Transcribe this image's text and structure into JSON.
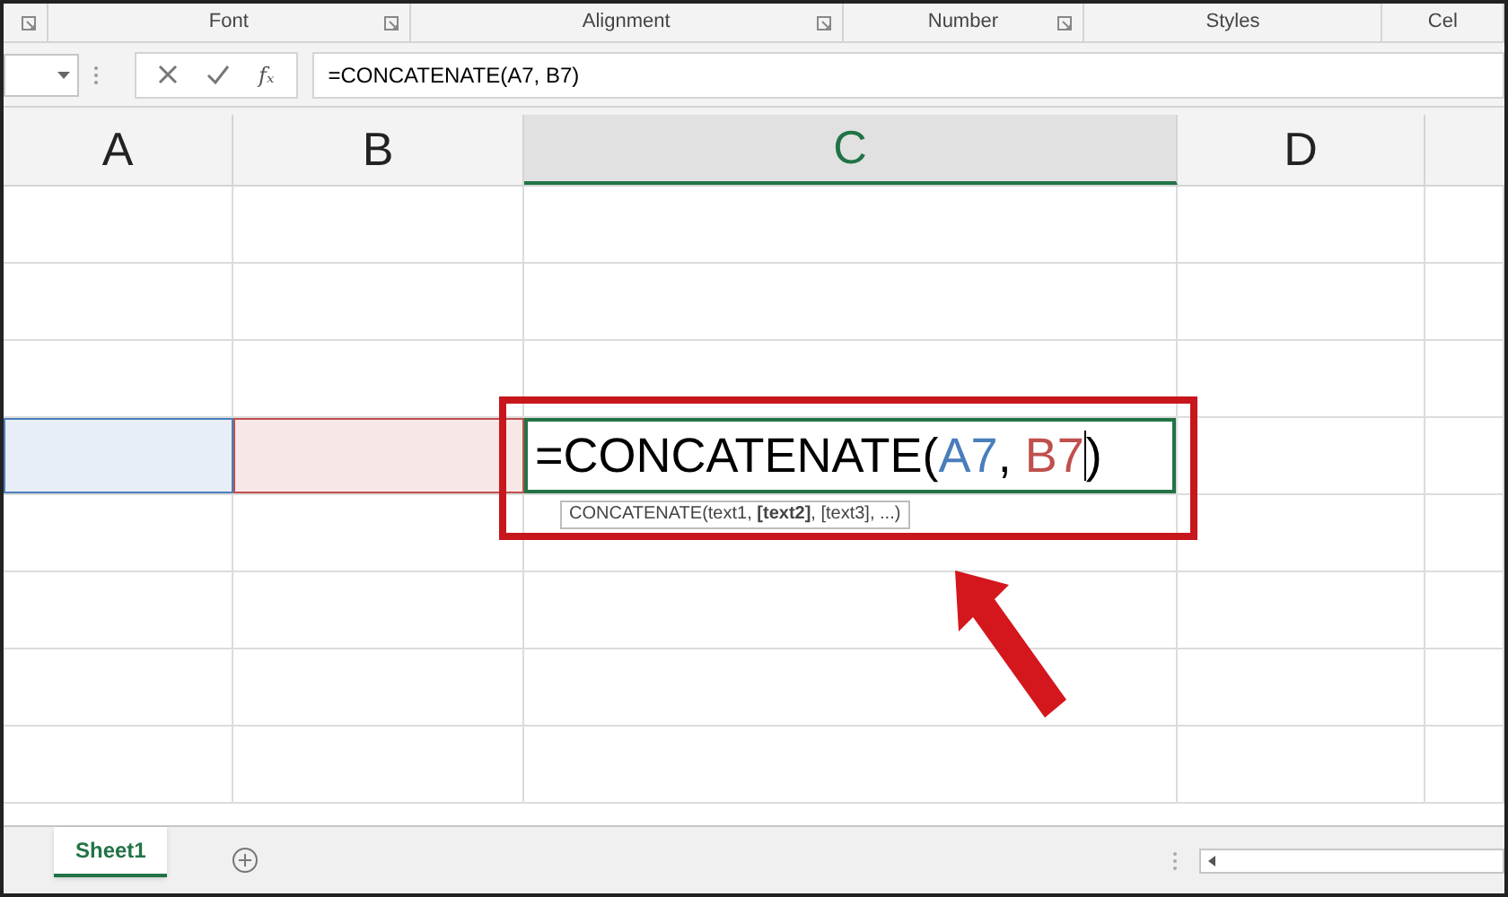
{
  "ribbon_groups": [
    {
      "launcher": true
    },
    {
      "label": "Font",
      "launcher": true
    },
    {
      "label": "Alignment",
      "launcher": true
    },
    {
      "label": "Number",
      "launcher": true
    },
    {
      "label": "Styles",
      "launcher": false
    },
    {
      "label": "Cel",
      "launcher": false
    }
  ],
  "formula_bar": {
    "fx_label": "fₓ",
    "formula": "=CONCATENATE(A7, B7)"
  },
  "columns": [
    {
      "label": "A",
      "selected": false
    },
    {
      "label": "B",
      "selected": false
    },
    {
      "label": "C",
      "selected": true
    },
    {
      "label": "D",
      "selected": false
    }
  ],
  "active_row": {
    "referenced_cells": [
      {
        "color": "#4a7ebb"
      },
      {
        "color": "#c0504d"
      }
    ],
    "formula_parts": [
      {
        "text": "=CONCATENATE("
      },
      {
        "text": "A7",
        "color": "#4a7ebb"
      },
      {
        "text": ", "
      },
      {
        "text": "B7",
        "color": "#c0504d"
      },
      {
        "text": ")"
      }
    ],
    "tooltip": "CONCATENATE(text1, **[text2]**, [text3], ...)"
  },
  "sheet_tabs": [
    {
      "label": "Sheet1",
      "selected": true
    }
  ]
}
